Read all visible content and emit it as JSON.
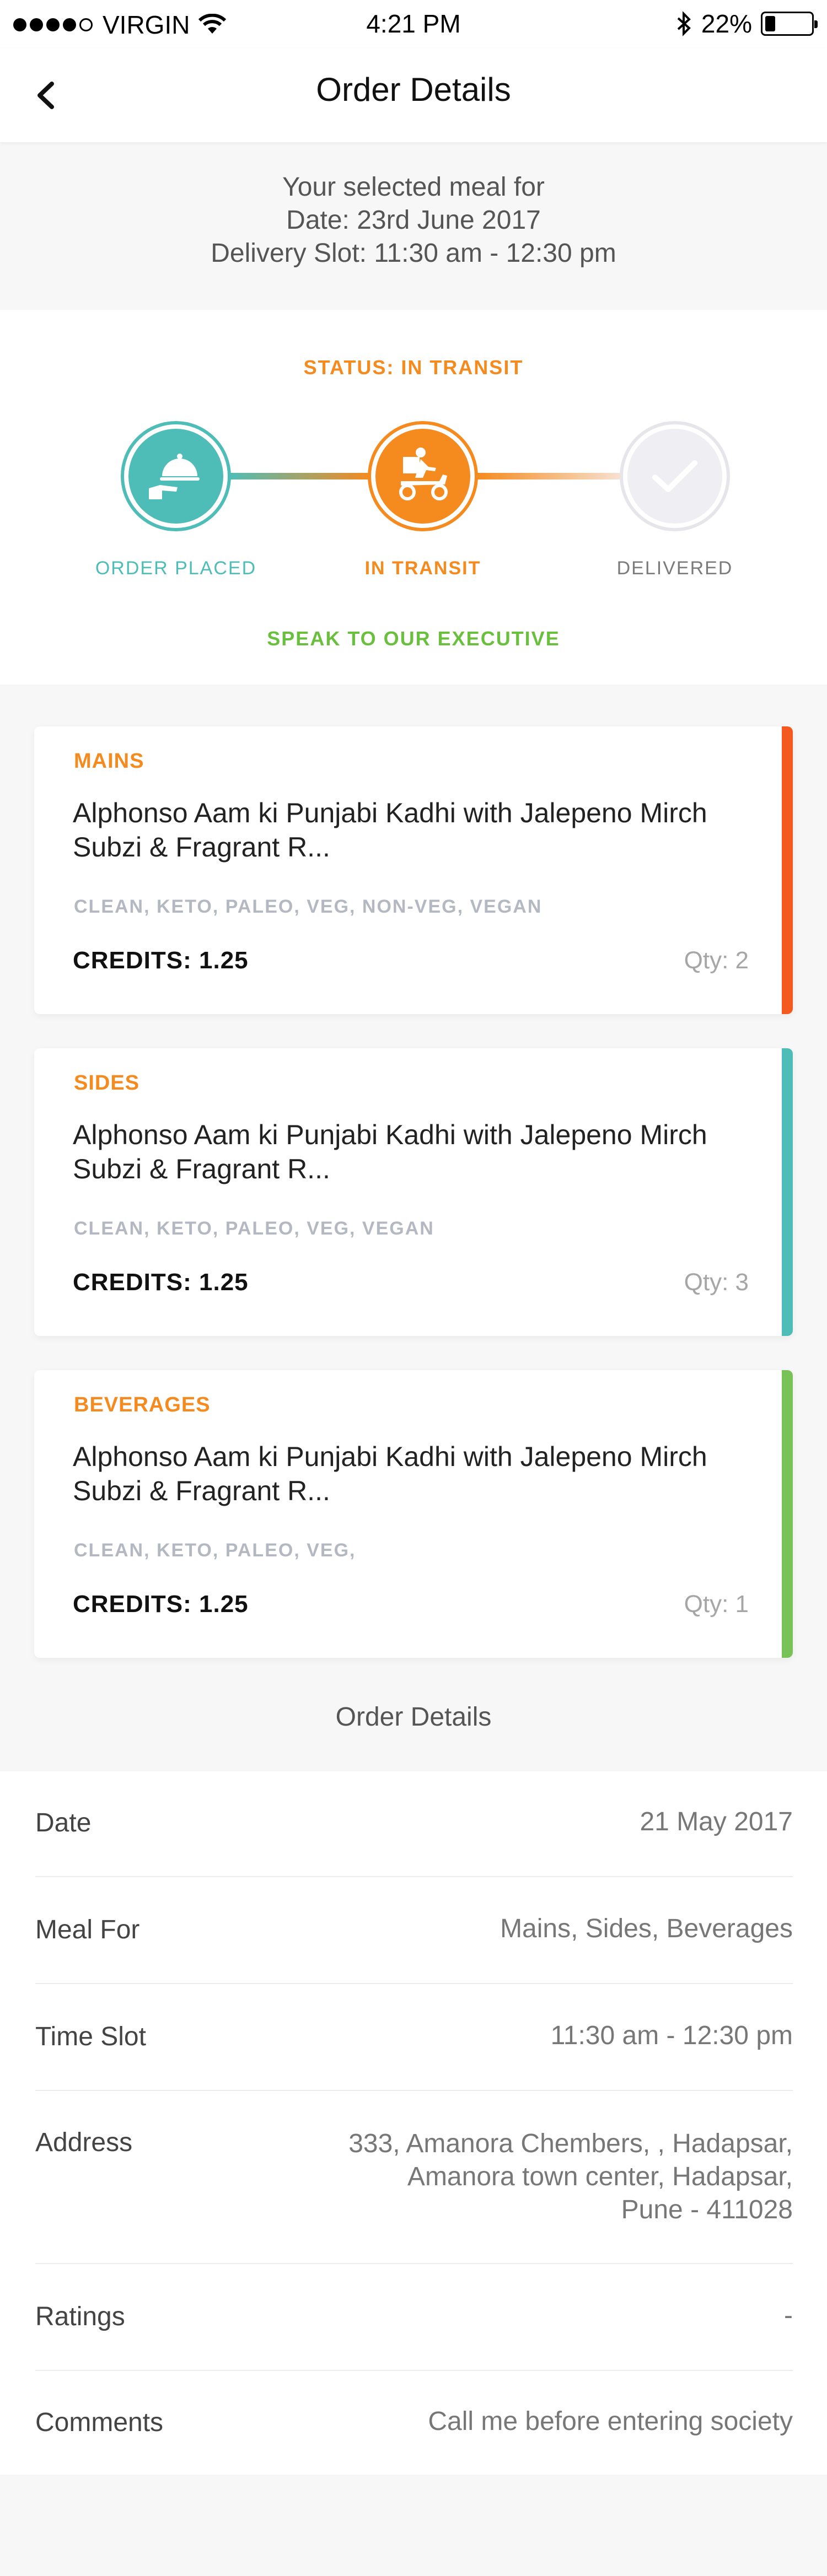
{
  "status_bar": {
    "carrier": "VIRGIN",
    "time": "4:21 PM",
    "battery": "22%",
    "battery_level": 0.22
  },
  "nav": {
    "title": "Order Details"
  },
  "meal_info": {
    "line1": "Your selected meal for",
    "line2": "Date: 23rd June 2017",
    "line3": "Delivery Slot: 11:30 am - 12:30 pm"
  },
  "status": {
    "label": "STATUS: IN TRANSIT",
    "steps": [
      {
        "label": "ORDER PLACED",
        "icon": "serving-tray-icon",
        "state": "done"
      },
      {
        "label": "IN TRANSIT",
        "icon": "delivery-scooter-icon",
        "state": "current"
      },
      {
        "label": "DELIVERED",
        "icon": "checkmark-icon",
        "state": "pending"
      }
    ],
    "speak": "SPEAK TO OUR EXECUTIVE"
  },
  "items": [
    {
      "category": "MAINS",
      "name": "Alphonso Aam ki Punjabi Kadhi with Jalepeno Mirch Subzi & Fragrant R...",
      "tags": "CLEAN, KETO, PALEO, VEG, NON-VEG, VEGAN",
      "credits": "CREDITS: 1.25",
      "qty": "Qty: 2",
      "accent": "#f45a1f"
    },
    {
      "category": "SIDES",
      "name": "Alphonso Aam ki Punjabi Kadhi with Jalepeno Mirch Subzi & Fragrant R...",
      "tags": "CLEAN, KETO, PALEO, VEG, VEGAN",
      "credits": "CREDITS: 1.25",
      "qty": "Qty: 3",
      "accent": "#4fbdb7"
    },
    {
      "category": "BEVERAGES",
      "name": "Alphonso Aam ki Punjabi Kadhi with Jalepeno Mirch Subzi & Fragrant R...",
      "tags": "CLEAN, KETO, PALEO, VEG,",
      "credits": "CREDITS: 1.25",
      "qty": "Qty: 1",
      "accent": "#78c257"
    }
  ],
  "order_details": {
    "heading": "Order Details",
    "rows": [
      {
        "label": "Date",
        "value": "21 May 2017"
      },
      {
        "label": "Meal For",
        "value": "Mains, Sides, Beverages"
      },
      {
        "label": "Time Slot",
        "value": "11:30 am - 12:30 pm"
      },
      {
        "label": "Address",
        "value": "333, Amanora Chembers, , Hadapsar,\nAmanora town center, Hadapsar,\nPune - 411028"
      },
      {
        "label": "Ratings",
        "value": "-"
      },
      {
        "label": "Comments",
        "value": "Call me before entering society"
      }
    ]
  },
  "colors": {
    "orange": "#f58a1f",
    "teal": "#4fbdb7",
    "green": "#6bbf3e"
  }
}
